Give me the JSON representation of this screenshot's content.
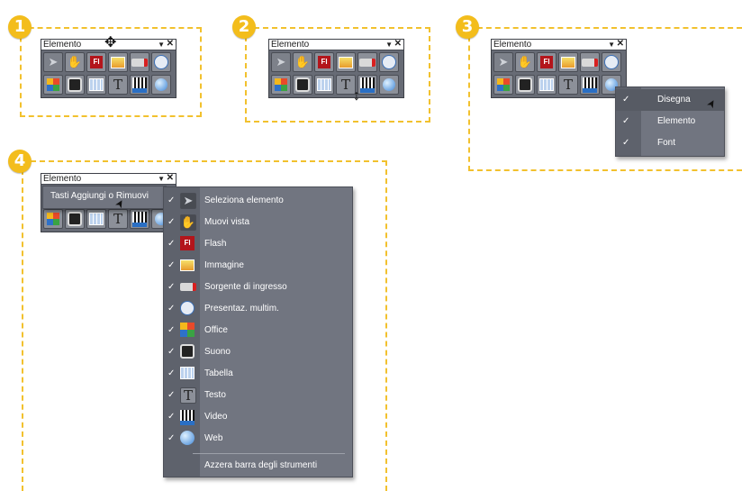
{
  "steps": [
    "1",
    "2",
    "3",
    "4"
  ],
  "toolbar": {
    "title": "Elemento",
    "dropdown_glyph": "▼",
    "close_glyph": "✕",
    "row1_icons": [
      "arrow-icon",
      "hand-icon",
      "flash-icon",
      "image-icon",
      "input-source-icon",
      "presentation-icon"
    ],
    "row2_icons": [
      "office-icon",
      "sound-icon",
      "table-icon",
      "text-icon",
      "video-icon",
      "web-icon"
    ]
  },
  "context_menu": {
    "items": [
      {
        "label": "Disegna",
        "checked": true,
        "highlighted": true
      },
      {
        "label": "Elemento",
        "checked": true
      },
      {
        "label": "Font",
        "checked": true
      }
    ]
  },
  "customize_popup": {
    "label": "Tasti Aggiungi o Rimuovi",
    "items": [
      {
        "label": "Seleziona elemento",
        "icon": "arrow-icon",
        "checked": true
      },
      {
        "label": "Muovi vista",
        "icon": "hand-icon",
        "checked": true
      },
      {
        "label": "Flash",
        "icon": "flash-icon",
        "checked": true
      },
      {
        "label": "Immagine",
        "icon": "image-icon",
        "checked": true
      },
      {
        "label": "Sorgente di ingresso",
        "icon": "input-source-icon",
        "checked": true
      },
      {
        "label": "Presentaz. multim.",
        "icon": "presentation-icon",
        "checked": true
      },
      {
        "label": "Office",
        "icon": "office-icon",
        "checked": true
      },
      {
        "label": "Suono",
        "icon": "sound-icon",
        "checked": true
      },
      {
        "label": "Tabella",
        "icon": "table-icon",
        "checked": true
      },
      {
        "label": "Testo",
        "icon": "text-icon",
        "checked": true
      },
      {
        "label": "Video",
        "icon": "video-icon",
        "checked": true
      },
      {
        "label": "Web",
        "icon": "web-icon",
        "checked": true
      }
    ],
    "reset_label": "Azzera barra degli strumenti"
  },
  "glyphs": {
    "check": "✓",
    "flash_text": "Fl",
    "text_icon": "T",
    "move_cursor": "✥",
    "resize_cursor": "↕",
    "pointer": "➤"
  },
  "colors": {
    "accent_dashed": "#f2c12e",
    "badge": "#f3bd1c",
    "menu_bg": "#717580",
    "toolbar_bg": "#676b75"
  }
}
